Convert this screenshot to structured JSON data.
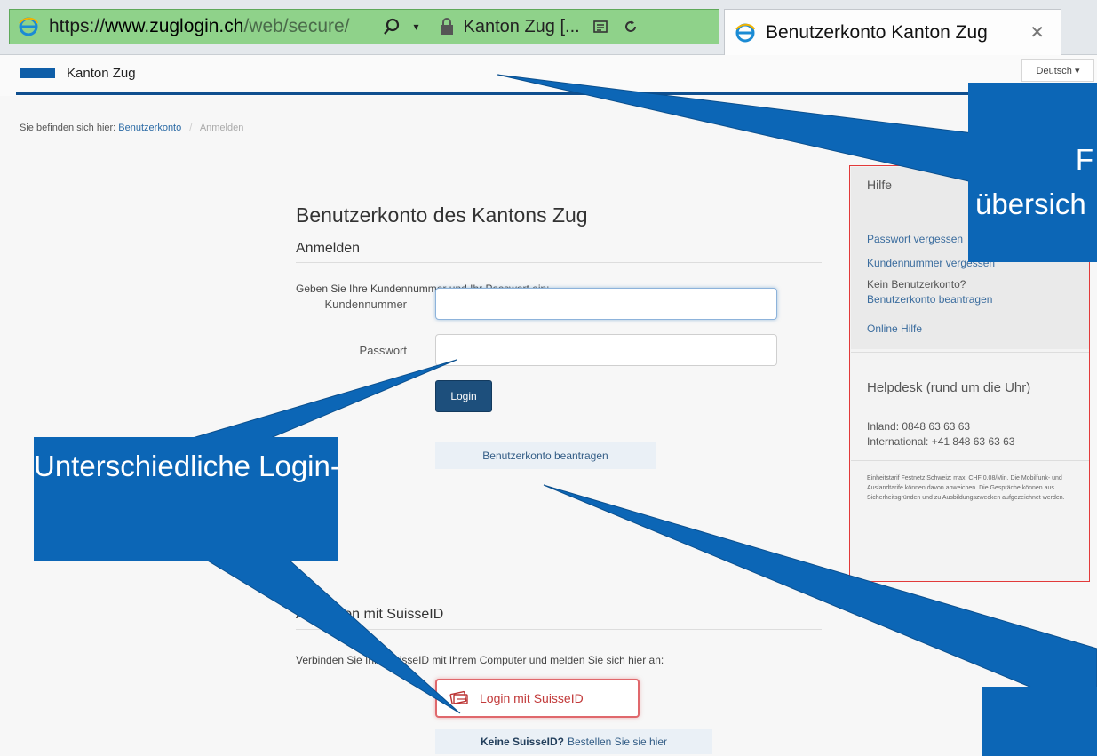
{
  "browser": {
    "url_scheme": "https://",
    "url_domain": "www.zuglogin.ch",
    "url_path": "/web/secure/",
    "site_identity": "Kanton Zug [...",
    "tab_title": "Benutzerkonto Kanton Zug",
    "close_glyph": "✕"
  },
  "header": {
    "brand": "Kanton Zug",
    "language": "Deutsch ▾",
    "brand_color": "#0f5ea8"
  },
  "breadcrumb": {
    "prefix": "Sie befinden sich hier:",
    "link": "Benutzerkonto",
    "separator": "/",
    "current": "Anmelden"
  },
  "login": {
    "title": "Benutzerkonto des Kantons Zug",
    "section": "Anmelden",
    "intro": "Geben Sie Ihre Kundennummer und Ihr Passwort ein:",
    "customer_label": "Kundennummer",
    "password_label": "Passwort",
    "customer_value": "",
    "password_value": "",
    "login_button": "Login",
    "apply_button": "Benutzerkonto beantragen"
  },
  "suisseid": {
    "section": "Anmelden mit SuisseID",
    "intro": "Verbinden Sie Ihre SuisseID mit Ihrem Computer und melden Sie sich hier an:",
    "button": "Login mit SuisseID",
    "no_id_bold": "Keine SuisseID?",
    "no_id_link": "Bestellen Sie sie hier"
  },
  "help": {
    "heading": "Hilfe",
    "link_forgot_password": "Passwort vergessen",
    "link_forgot_customer": "Kundennummer vergessen",
    "no_account": "Kein Benutzerkonto?",
    "link_apply": "Benutzerkonto beantragen",
    "link_online_help": "Online Hilfe",
    "helpdesk_heading": "Helpdesk (rund um die Uhr)",
    "inland": "Inland: 0848 63 63 63",
    "international": "International: +41 848 63 63 63",
    "fine_print": "Einheitstarif Festnetz Schweiz: max. CHF 0.08/Min. Die Mobilfunk- und Auslandtarife können davon abweichen. Die Gespräche können aus Sicherheitsgründen und zu Ausbildungszwecken aufgezeichnet werden."
  },
  "callouts": {
    "main": "Unterschiedliche Login-Verfahren",
    "top_line1": "F",
    "top_line2": "übersich",
    "color": "#0c66b6"
  }
}
